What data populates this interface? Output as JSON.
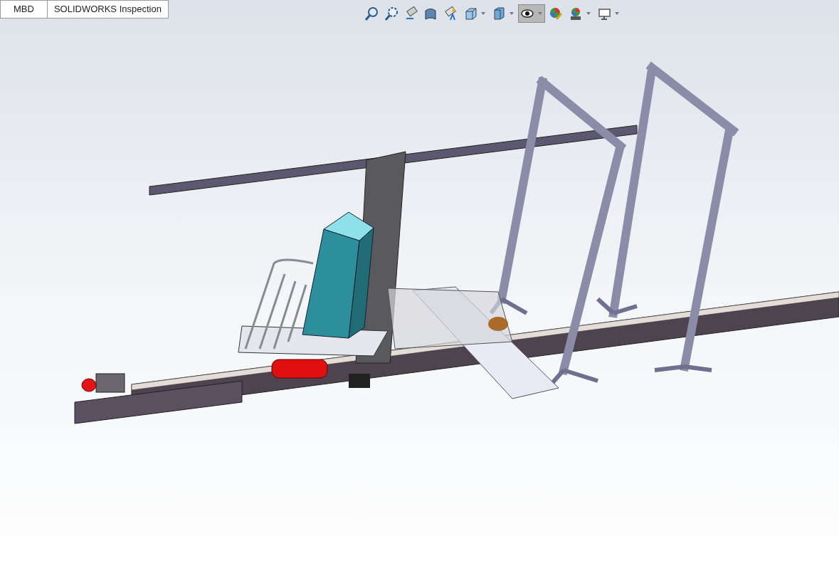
{
  "tabs": [
    {
      "label": "MBD"
    },
    {
      "label": "SOLIDWORKS Inspection"
    }
  ],
  "view_toolbar": [
    {
      "kind": "zoom-fit",
      "dropdown": false,
      "active": false
    },
    {
      "kind": "zoom-area",
      "dropdown": false,
      "active": false
    },
    {
      "kind": "previous-view",
      "dropdown": false,
      "active": false
    },
    {
      "kind": "section-view",
      "dropdown": false,
      "active": false
    },
    {
      "kind": "dynamic-annotation",
      "dropdown": false,
      "active": false
    },
    {
      "kind": "view-orientation",
      "dropdown": true,
      "active": false
    },
    {
      "kind": "display-style",
      "dropdown": true,
      "active": false
    },
    {
      "kind": "hide-show",
      "dropdown": true,
      "active": true
    },
    {
      "kind": "edit-appearance",
      "dropdown": false,
      "active": false
    },
    {
      "kind": "apply-scene",
      "dropdown": true,
      "active": false
    },
    {
      "kind": "view-settings",
      "dropdown": true,
      "active": false
    }
  ]
}
